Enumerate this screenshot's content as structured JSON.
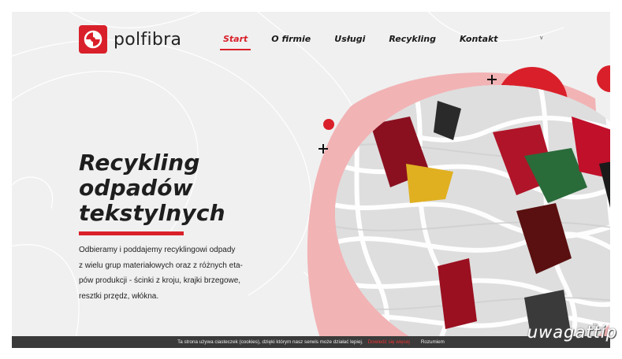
{
  "brand": {
    "name": "polfibra",
    "accent_color": "#d9202a"
  },
  "nav": {
    "items": [
      {
        "label": "Start",
        "active": true
      },
      {
        "label": "O firmie",
        "active": false
      },
      {
        "label": "Usługi",
        "active": false
      },
      {
        "label": "Recykling",
        "active": false
      },
      {
        "label": "Kontakt",
        "active": false
      }
    ],
    "lang_toggle": "v"
  },
  "hero": {
    "title_line1": "Recykling",
    "title_line2": "odpadów",
    "title_line3": "tekstylnych",
    "text_line1": "Odbieramy i poddajemy recyklingowi odpady",
    "text_line2": "z wielu grup materiałowych oraz z różnych eta-",
    "text_line3": "pów produkcji - ścinki z kroju, krajki brzegowe,",
    "text_line4": "resztki przędz, włókna.",
    "image_icon": "textile-waste-photo"
  },
  "cookie": {
    "text": "Ta strona używa ciasteczek (cookies), dzięki którym nasz serwis może działać lepiej.",
    "link": "Dowiedz się więcej",
    "accept": "Rozumiem"
  },
  "watermark": {
    "text": "uwagattip",
    "small": "ttip"
  }
}
